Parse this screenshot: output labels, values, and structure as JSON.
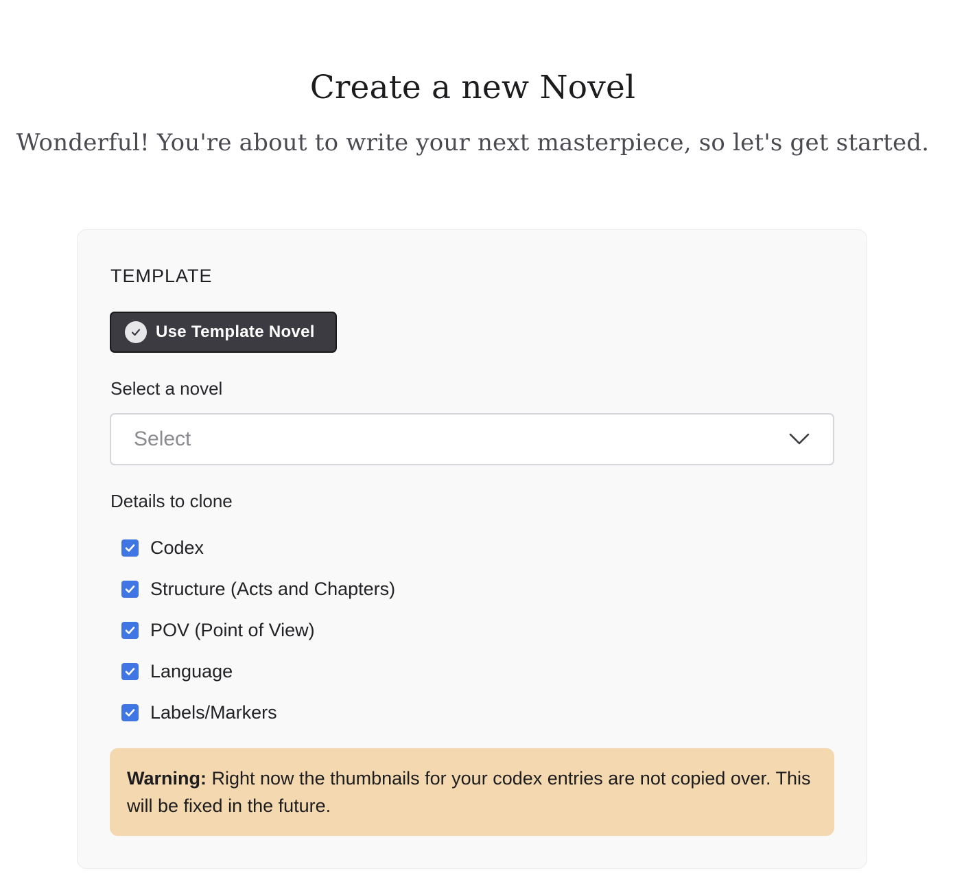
{
  "header": {
    "title": "Create a new Novel",
    "subtitle": "Wonderful! You're about to write your next masterpiece, so let's get started."
  },
  "template_section": {
    "heading": "TEMPLATE",
    "use_template_button": {
      "label": "Use Template Novel",
      "icon": "check-circle-icon",
      "active": true
    },
    "select_novel": {
      "label": "Select a novel",
      "placeholder": "Select",
      "value": "",
      "icon": "chevron-down-icon"
    },
    "details_to_clone": {
      "label": "Details to clone",
      "options": [
        {
          "label": "Codex",
          "checked": true
        },
        {
          "label": "Structure (Acts and Chapters)",
          "checked": true
        },
        {
          "label": "POV (Point of View)",
          "checked": true
        },
        {
          "label": "Language",
          "checked": true
        },
        {
          "label": "Labels/Markers",
          "checked": true
        }
      ]
    },
    "warning": {
      "strong": "Warning:",
      "text": " Right now the thumbnails for your codex entries are not copied over. This will be fixed in the future."
    }
  },
  "colors": {
    "checkbox": "#3f76e4",
    "button_bg": "#3b3b41",
    "warning_bg": "#f3d8b0",
    "card_bg": "#f9f9f9"
  }
}
